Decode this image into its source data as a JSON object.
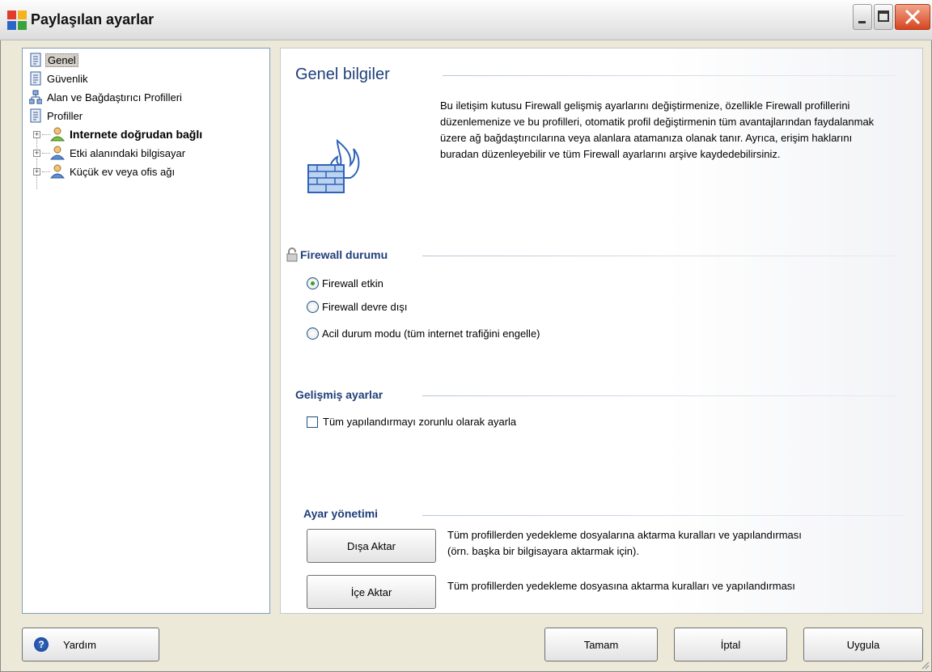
{
  "window": {
    "title": "Paylaşılan ayarlar"
  },
  "tree": {
    "items": [
      {
        "label": "Genel",
        "icon": "document-icon",
        "selected": true
      },
      {
        "label": "Güvenlik",
        "icon": "document-icon"
      },
      {
        "label": "Alan ve Bağdaştırıcı Profilleri",
        "icon": "network-icon"
      },
      {
        "label": "Profiller",
        "icon": "document-icon"
      },
      {
        "label": "Internete doğrudan bağlı",
        "icon": "person-icon",
        "expander": "+"
      },
      {
        "label": "Etki alanındaki bilgisayar",
        "icon": "person-icon",
        "expander": "+"
      },
      {
        "label": "Küçük ev veya ofis ağı",
        "icon": "person-icon",
        "expander": "+"
      }
    ]
  },
  "main": {
    "title": "Genel bilgiler",
    "description": "Bu iletişim kutusu Firewall gelişmiş ayarlarını değiştirmenize, özellikle Firewall profillerini düzenlemenize ve bu profilleri, otomatik profil değiştirmenin tüm avantajlarından faydalanmak üzere ağ bağdaştırıcılarına veya alanlara atamanıza olanak tanır. Ayrıca, erişim haklarını buradan düzenleyebilir ve tüm Firewall ayarlarını arşive kaydedebilirsiniz.",
    "firewall_status": {
      "heading": "Firewall durumu",
      "options": [
        {
          "label": "Firewall etkin",
          "checked": true
        },
        {
          "label": "Firewall devre dışı",
          "checked": false
        },
        {
          "label": "Acil durum modu (tüm internet trafiğini engelle)",
          "checked": false
        }
      ]
    },
    "advanced": {
      "heading": "Gelişmiş ayarlar",
      "checkbox_label": "Tüm yapılandırmayı zorunlu olarak ayarla",
      "checked": false
    },
    "management": {
      "heading": "Ayar yönetimi",
      "export_button": "Dışa Aktar",
      "export_note_line1": "Tüm profillerden yedekleme dosyalarına aktarma kuralları ve yapılandırması",
      "export_note_line2": "(örn. başka bir bilgisayara aktarmak için).",
      "import_button": "İçe Aktar",
      "import_note": "Tüm profillerden yedekleme dosyasına aktarma kuralları ve yapılandırması"
    }
  },
  "footer": {
    "help": "Yardım",
    "ok": "Tamam",
    "cancel": "İptal",
    "apply": "Uygula"
  },
  "colors": {
    "heading": "#1f3f7a",
    "accent": "#2fa22f"
  }
}
